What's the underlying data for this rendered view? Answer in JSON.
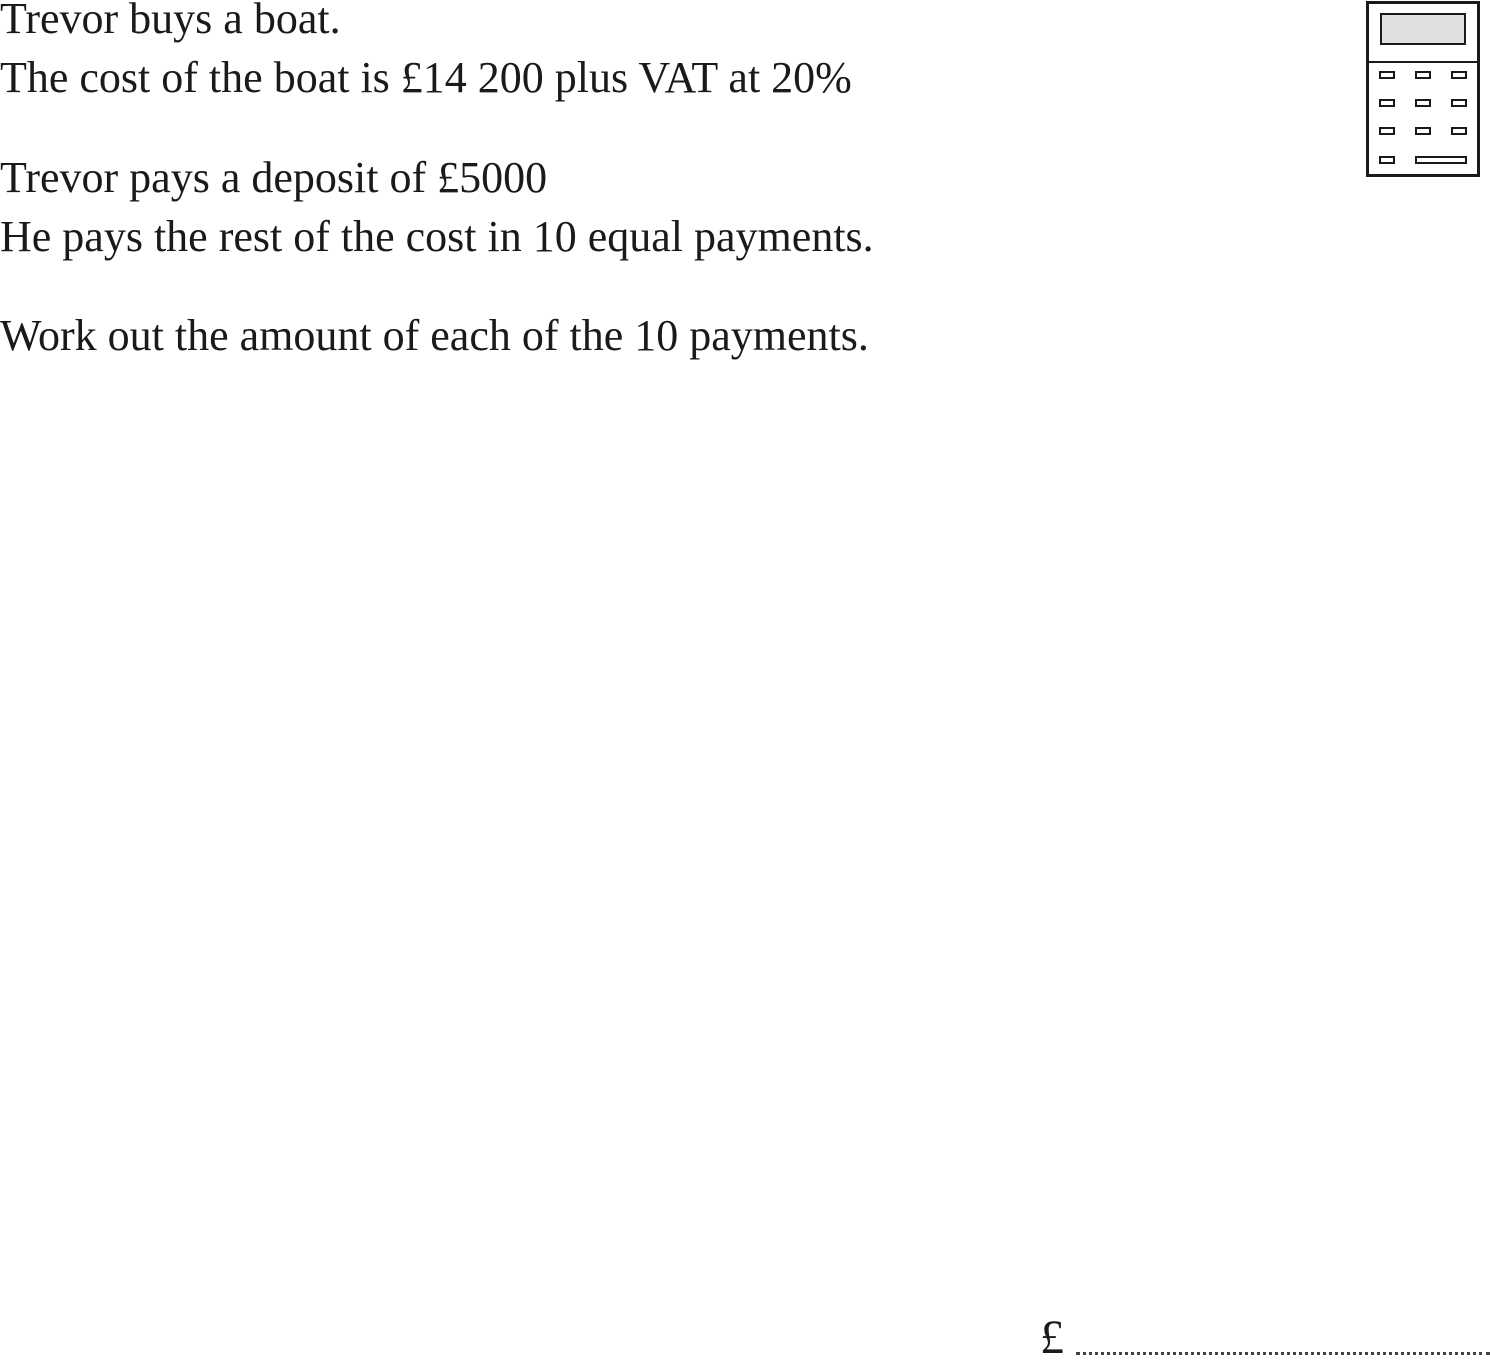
{
  "question": {
    "lines": [
      "Trevor buys a boat.",
      "The cost of the boat is £14 200 plus VAT at 20%",
      "Trevor pays a deposit of £5000",
      "He pays the rest of the cost in 10 equal payments.",
      "Work out the amount of each of the 10 payments."
    ]
  },
  "calculator_icon": {
    "icon": "calculator-icon",
    "screen_fill": "#e0e0e0",
    "stroke": "#1a1a1a"
  },
  "answer": {
    "currency": "£",
    "value": ""
  }
}
